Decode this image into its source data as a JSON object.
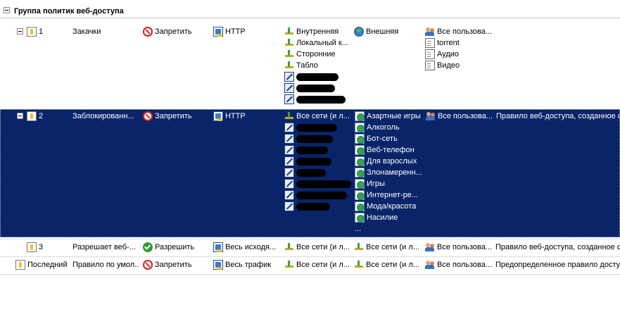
{
  "group": {
    "title": "Группа политик веб-доступа"
  },
  "rows": [
    {
      "order": "1",
      "name": "Закачки",
      "action": "Запретить",
      "protocol": "HTTP",
      "from": [
        "Внутренняя",
        "Локальный к...",
        "Сторонние",
        "Табло"
      ],
      "to": [
        "Внешняя"
      ],
      "users": [
        "Все пользова..."
      ],
      "content": [
        "torrent",
        "Аудио",
        "Видео"
      ],
      "description": ""
    },
    {
      "order": "2",
      "name": "Заблокированн...",
      "action": "Запретить",
      "protocol": "HTTP",
      "from": [
        "Все сети (и л..."
      ],
      "to": [
        "Азартные игры",
        "Алкоголь",
        "Бот-сеть",
        "Веб-телефон",
        "Для взрослых",
        "Злонамеренн...",
        "Игры",
        "Интернет-ре...",
        "Мода/красота",
        "Насилие",
        "..."
      ],
      "users": [
        "Все пользова..."
      ],
      "description": "Правило веб-доступа, созданное с"
    },
    {
      "order": "3",
      "name": "Разрешает веб-...",
      "action": "Разрешить",
      "protocol": "Весь исходя...",
      "from": [
        "Все сети (и л..."
      ],
      "to": [
        "Все сети (и л..."
      ],
      "users": [
        "Все пользова..."
      ],
      "description": "Правило веб-доступа, созданное с"
    },
    {
      "order": "Последний",
      "name": "Правило по умол...",
      "action": "Запретить",
      "protocol": "Весь трафик",
      "from": [
        "Все сети (и л..."
      ],
      "to": [
        "Все сети (и л..."
      ],
      "users": [
        "Все пользова..."
      ],
      "description": "Предопределенное правило досту"
    }
  ]
}
